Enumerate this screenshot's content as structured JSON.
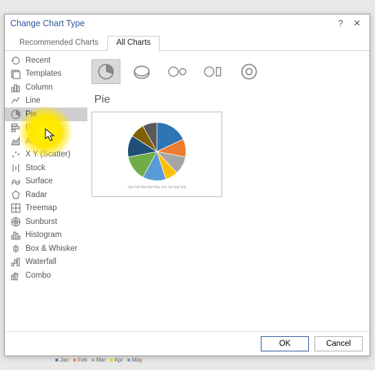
{
  "dialog": {
    "title": "Change Chart Type",
    "help_label": "?",
    "close_label": "✕"
  },
  "tabs": {
    "recommended": "Recommended Charts",
    "all": "All Charts"
  },
  "sidebar": {
    "items": [
      {
        "icon": "recent",
        "label": "Recent"
      },
      {
        "icon": "templates",
        "label": "Templates"
      },
      {
        "icon": "column",
        "label": "Column"
      },
      {
        "icon": "line",
        "label": "Line"
      },
      {
        "icon": "pie",
        "label": "Pie"
      },
      {
        "icon": "bar",
        "label": "Bar"
      },
      {
        "icon": "area",
        "label": "Area"
      },
      {
        "icon": "scatter",
        "label": "X Y (Scatter)"
      },
      {
        "icon": "stock",
        "label": "Stock"
      },
      {
        "icon": "surface",
        "label": "Surface"
      },
      {
        "icon": "radar",
        "label": "Radar"
      },
      {
        "icon": "treemap",
        "label": "Treemap"
      },
      {
        "icon": "sunburst",
        "label": "Sunburst"
      },
      {
        "icon": "histogram",
        "label": "Histogram"
      },
      {
        "icon": "boxwhisker",
        "label": "Box & Whisker"
      },
      {
        "icon": "waterfall",
        "label": "Waterfall"
      },
      {
        "icon": "combo",
        "label": "Combo"
      }
    ],
    "selected_index": 4
  },
  "main": {
    "heading": "Pie",
    "selected_subtype": 0
  },
  "buttons": {
    "ok": "OK",
    "cancel": "Cancel"
  },
  "chart_data": {
    "type": "pie",
    "title": "",
    "series": [
      {
        "name": "Jan",
        "value": 18,
        "color": "#2e75b6"
      },
      {
        "name": "Feb",
        "value": 10,
        "color": "#ed7d31"
      },
      {
        "name": "Mar",
        "value": 10,
        "color": "#a5a5a5"
      },
      {
        "name": "Apr",
        "value": 7,
        "color": "#ffc000"
      },
      {
        "name": "May",
        "value": 13,
        "color": "#5b9bd5"
      },
      {
        "name": "Jun",
        "value": 14,
        "color": "#70ad47"
      },
      {
        "name": "Jul",
        "value": 12,
        "color": "#1f4e79"
      },
      {
        "name": "Aug",
        "value": 8,
        "color": "#7f6000"
      },
      {
        "name": "Sep",
        "value": 8,
        "color": "#595959"
      }
    ]
  },
  "footer_legend": [
    "Jan",
    "Feb",
    "Mar",
    "Apr",
    "May"
  ]
}
